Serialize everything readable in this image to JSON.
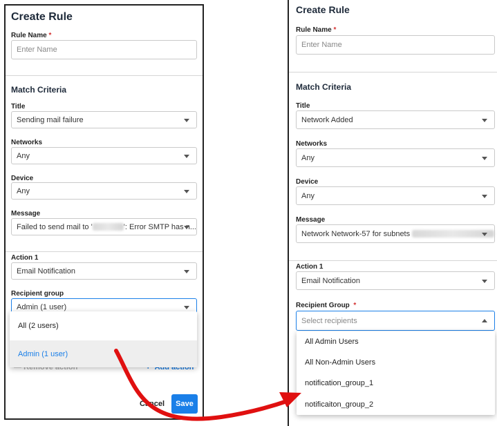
{
  "left": {
    "title": "Create Rule",
    "rule_name_label": "Rule Name",
    "required_mark": "*",
    "rule_name_placeholder": "Enter Name",
    "match_criteria": "Match Criteria",
    "title_label": "Title",
    "title_value": "Sending mail failure",
    "networks_label": "Networks",
    "networks_value": "Any",
    "device_label": "Device",
    "device_value": "Any",
    "message_label": "Message",
    "message_prefix": "Failed to send mail to '",
    "message_suffix": "': Error SMTP has n...",
    "action_label": "Action 1",
    "action_value": "Email Notification",
    "recipient_label": "Recipient group",
    "recipient_value": "Admin (1 user)",
    "dropdown_options": [
      "All (2 users)",
      "Admin (1 user)"
    ],
    "remove_action": "Remove action",
    "add_action": "Add action",
    "add_icon_glyph": "+",
    "cancel": "Cancel",
    "save": "Save"
  },
  "right": {
    "title": "Create Rule",
    "rule_name_label": "Rule Name",
    "required_mark": "*",
    "rule_name_placeholder": "Enter Name",
    "match_criteria": "Match Criteria",
    "title_label": "Title",
    "title_value": "Network Added",
    "networks_label": "Networks",
    "networks_value": "Any",
    "device_label": "Device",
    "device_value": "Any",
    "message_label": "Message",
    "message_prefix": "Network Network-57 for subnets",
    "action_label": "Action 1",
    "action_value": "Email Notification",
    "recipient_label": "Recipient Group",
    "recipient_placeholder": "Select recipients",
    "dropdown_options": [
      "All Admin Users",
      "All Non-Admin Users",
      "notification_group_1",
      "notificaiton_group_2"
    ]
  },
  "colors": {
    "accent": "#1a7fe8",
    "arrow": "#e01010",
    "required": "#d32f2f"
  }
}
